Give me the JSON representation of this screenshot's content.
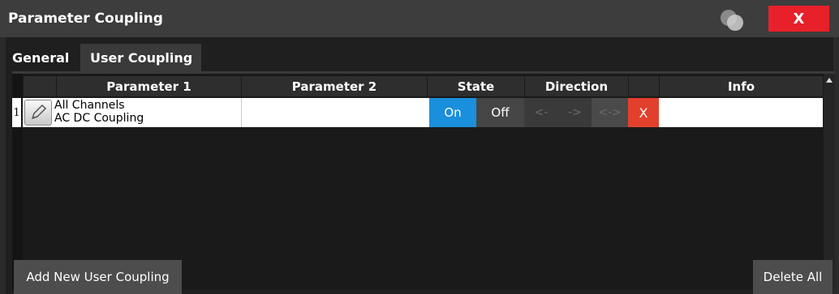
{
  "window": {
    "title": "Parameter Coupling",
    "close_label": "X"
  },
  "tabs": [
    {
      "label": "General",
      "active": false
    },
    {
      "label": "User Coupling",
      "active": true
    }
  ],
  "table": {
    "headers": {
      "param1": "Parameter 1",
      "param2": "Parameter 2",
      "state": "State",
      "direction": "Direction",
      "info": "Info"
    },
    "rows": [
      {
        "index": "1",
        "param1_line1": "All Channels",
        "param1_line2": "AC DC Coupling",
        "param2": "",
        "state_on": "On",
        "state_off": "Off",
        "state_selected": "On",
        "dir_left": "<-",
        "dir_right": "->",
        "dir_both": "<->",
        "delete_label": "X",
        "info": ""
      }
    ]
  },
  "footer": {
    "add_label": "Add New User Coupling",
    "delete_all_label": "Delete All"
  },
  "colors": {
    "accent": "#1a8fdc",
    "close": "#e8202a",
    "delete": "#e2402c",
    "background": "#2b2b2b"
  }
}
